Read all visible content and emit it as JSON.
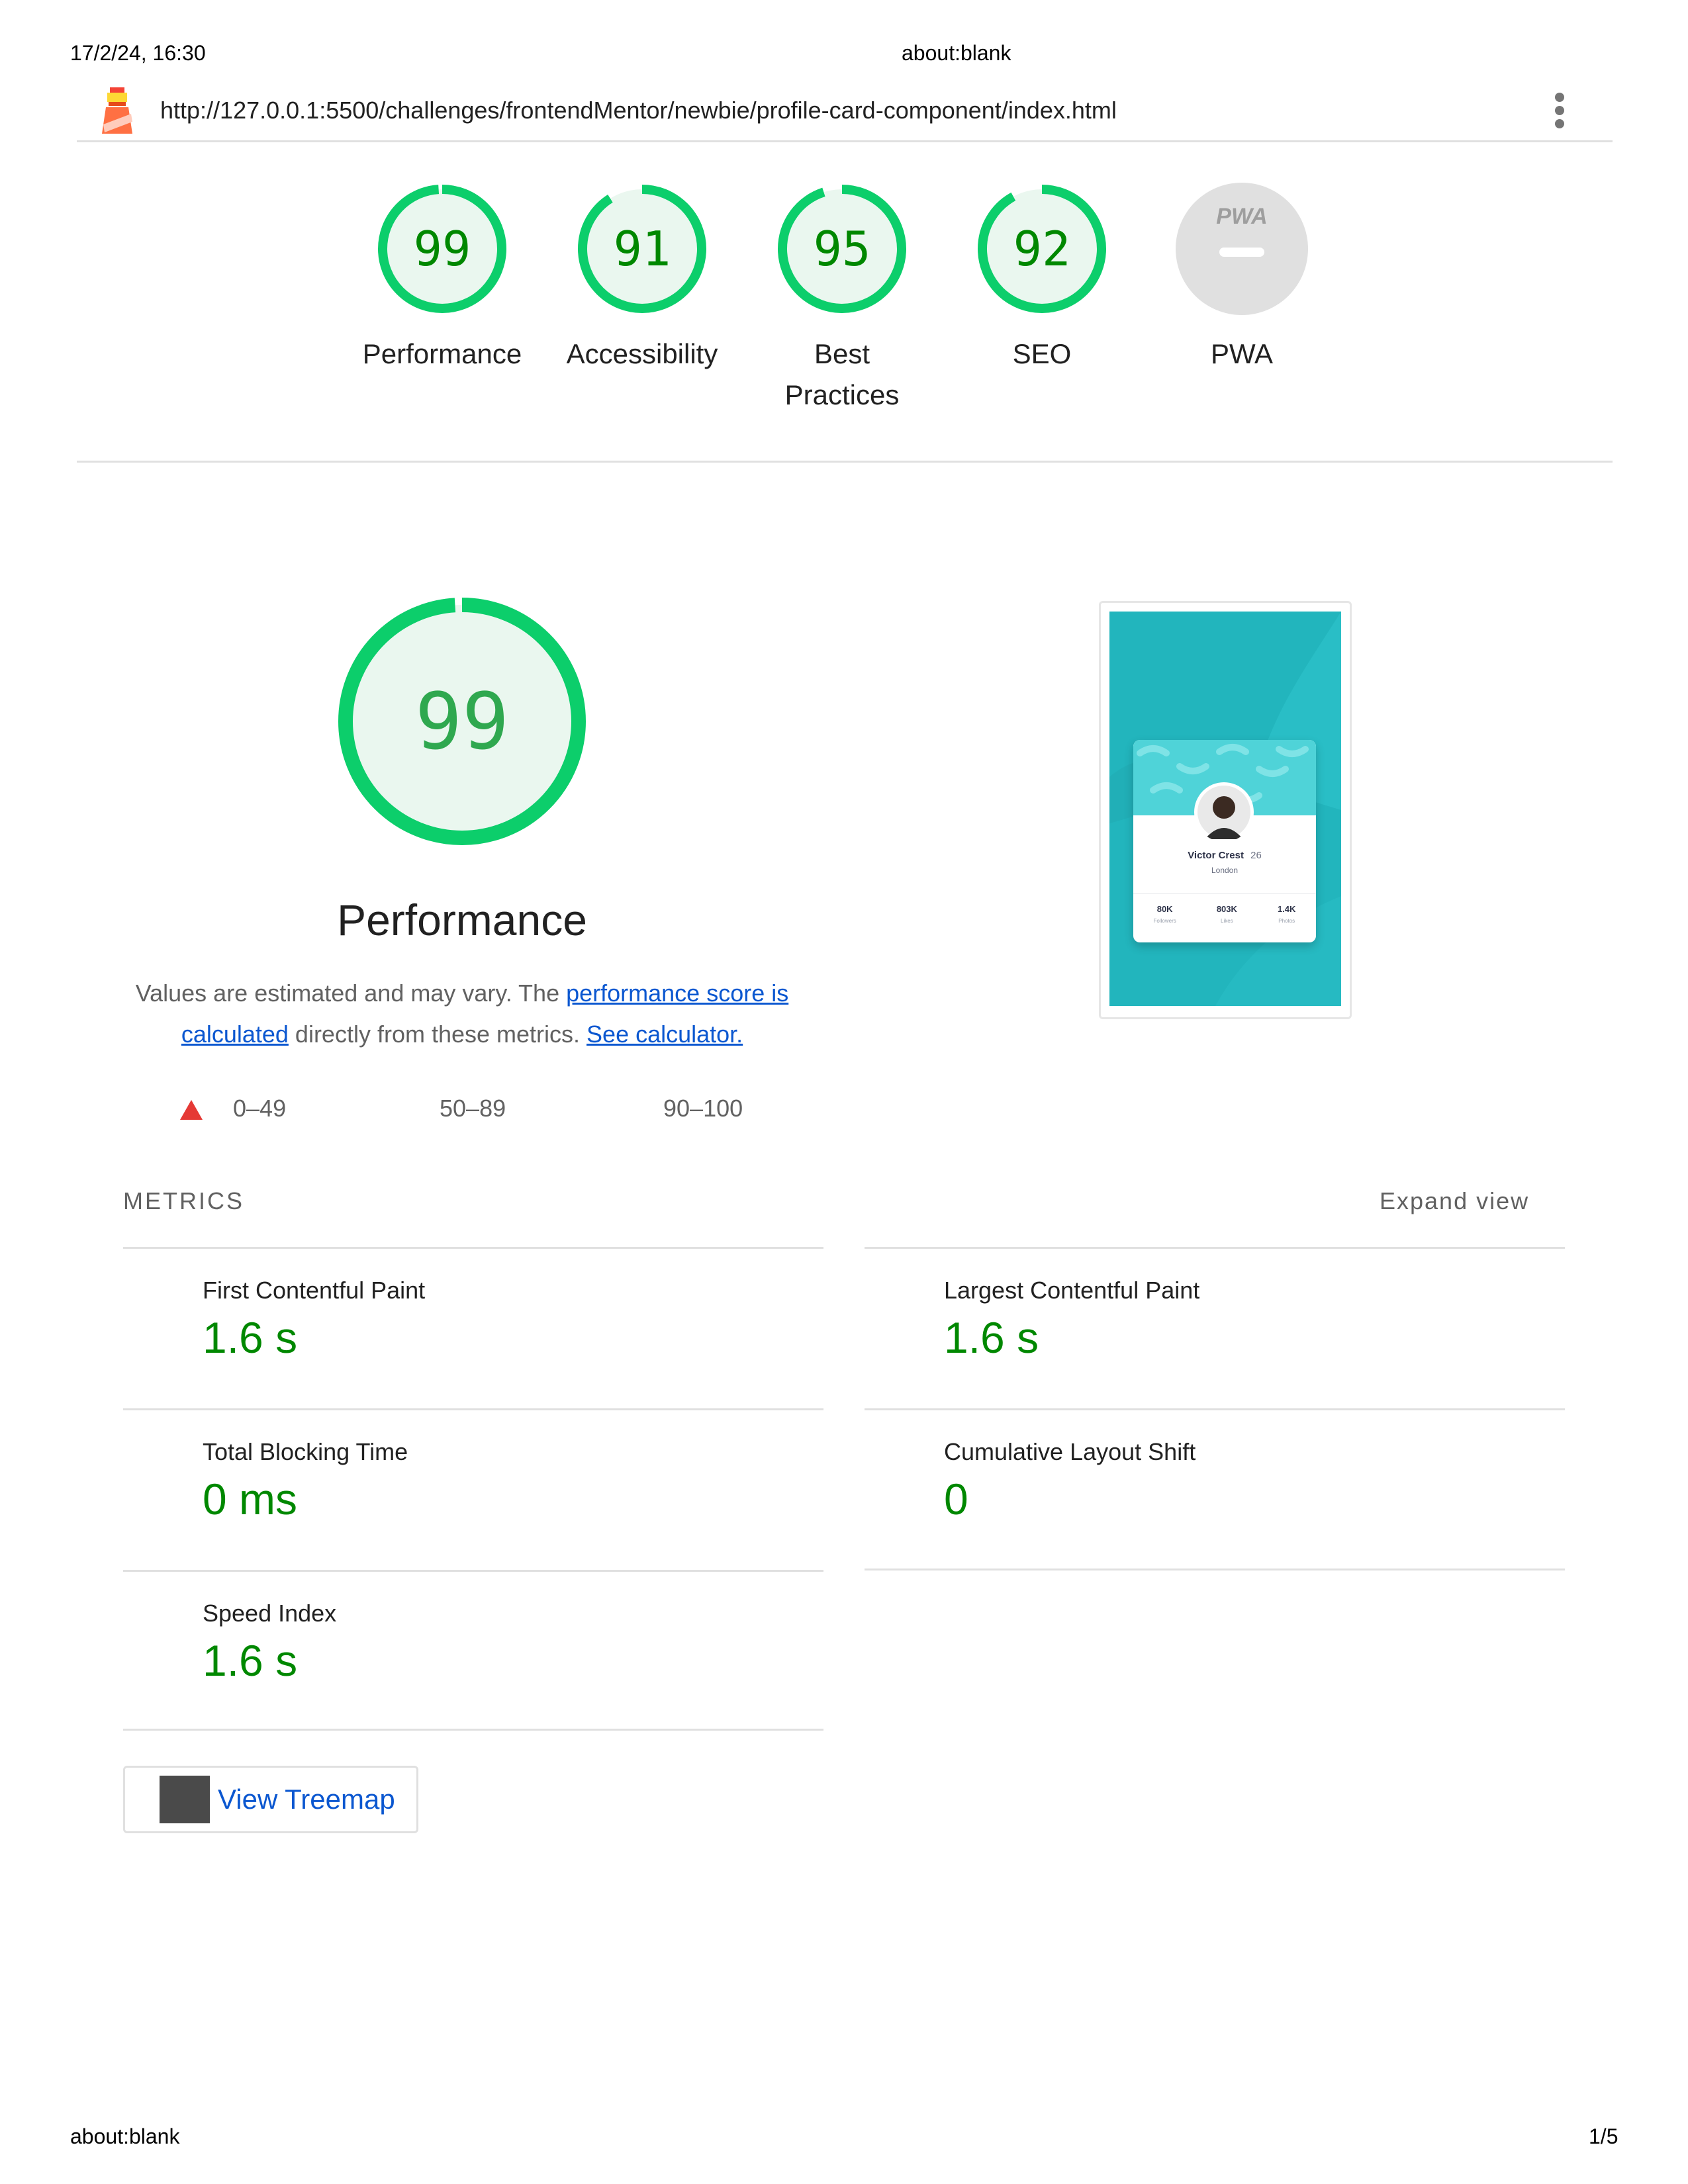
{
  "print_header": {
    "date": "17/2/24, 16:30",
    "title": "about:blank"
  },
  "print_footer": {
    "left": "about:blank",
    "page": "1/5"
  },
  "topbar": {
    "url": "http://127.0.0.1:5500/challenges/frontendMentor/newbie/profile-card-component/index.html"
  },
  "scores": [
    {
      "label": "Performance",
      "value": "99",
      "fraction": 0.99
    },
    {
      "label": "Accessibility",
      "value": "91",
      "fraction": 0.91
    },
    {
      "label": "Best\nPractices",
      "value": "95",
      "fraction": 0.95
    },
    {
      "label": "SEO",
      "value": "92",
      "fraction": 0.92
    },
    {
      "label": "PWA",
      "value": "",
      "badge": "PWA"
    }
  ],
  "performance": {
    "score": "99",
    "fraction": 0.99,
    "title": "Performance",
    "desc_prefix": "Values are estimated and may vary. The ",
    "desc_link1": "performance score is calculated",
    "desc_middle": " directly from these metrics. ",
    "desc_link2": "See calculator."
  },
  "legend": {
    "fail": "0–49",
    "average": "50–89",
    "pass": "90–100"
  },
  "screenshot": {
    "name": "Victor Crest",
    "age": "26",
    "city": "London",
    "stats": [
      {
        "value": "80K",
        "label": "Followers"
      },
      {
        "value": "803K",
        "label": "Likes"
      },
      {
        "value": "1.4K",
        "label": "Photos"
      }
    ]
  },
  "metrics_section": {
    "title": "METRICS",
    "expand": "Expand view"
  },
  "metrics": [
    {
      "label": "First Contentful Paint",
      "value": "1.6 s"
    },
    {
      "label": "Largest Contentful Paint",
      "value": "1.6 s"
    },
    {
      "label": "Total Blocking Time",
      "value": "0 ms"
    },
    {
      "label": "Cumulative Layout Shift",
      "value": "0"
    },
    {
      "label": "Speed Index",
      "value": "1.6 s"
    }
  ],
  "treemap": {
    "label": "View Treemap"
  },
  "colors": {
    "pass": "#0cce6b",
    "pass_text": "#008800",
    "fail": "#e53935",
    "link": "#0b57d0",
    "teal": "#22b5bd"
  }
}
